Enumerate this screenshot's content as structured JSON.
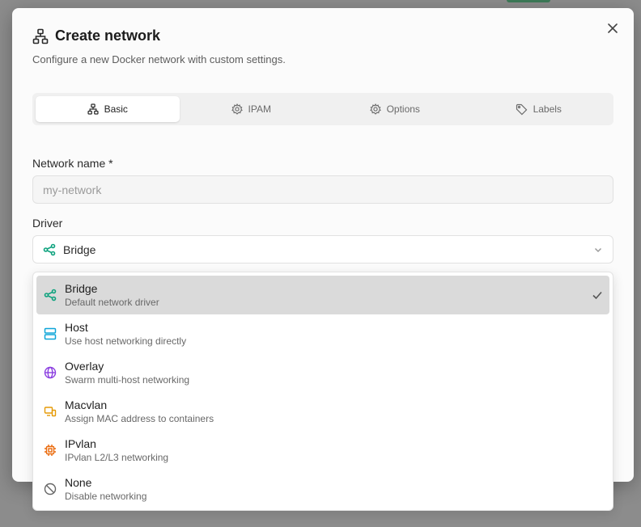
{
  "dialog": {
    "title": "Create network",
    "subtitle": "Configure a new Docker network with custom settings."
  },
  "tabs": [
    {
      "label": "Basic",
      "icon": "network-icon",
      "active": true
    },
    {
      "label": "IPAM",
      "icon": "gear-icon",
      "active": false
    },
    {
      "label": "Options",
      "icon": "gear-icon",
      "active": false
    },
    {
      "label": "Labels",
      "icon": "tag-icon",
      "active": false
    }
  ],
  "form": {
    "name_label": "Network name *",
    "name_placeholder": "my-network",
    "driver_label": "Driver",
    "driver_value": "Bridge"
  },
  "driver_options": [
    {
      "title": "Bridge",
      "desc": "Default network driver",
      "icon": "share-icon",
      "color": "#10a37f",
      "selected": true
    },
    {
      "title": "Host",
      "desc": "Use host networking directly",
      "icon": "server-icon",
      "color": "#0ea5d8",
      "selected": false
    },
    {
      "title": "Overlay",
      "desc": "Swarm multi-host networking",
      "icon": "globe-icon",
      "color": "#8b3fe0",
      "selected": false
    },
    {
      "title": "Macvlan",
      "desc": "Assign MAC address to containers",
      "icon": "devices-icon",
      "color": "#e59a06",
      "selected": false
    },
    {
      "title": "IPvlan",
      "desc": "IPvlan L2/L3 networking",
      "icon": "chip-icon",
      "color": "#ea6a0c",
      "selected": false
    },
    {
      "title": "None",
      "desc": "Disable networking",
      "icon": "off-icon",
      "color": "#666666",
      "selected": false
    }
  ]
}
